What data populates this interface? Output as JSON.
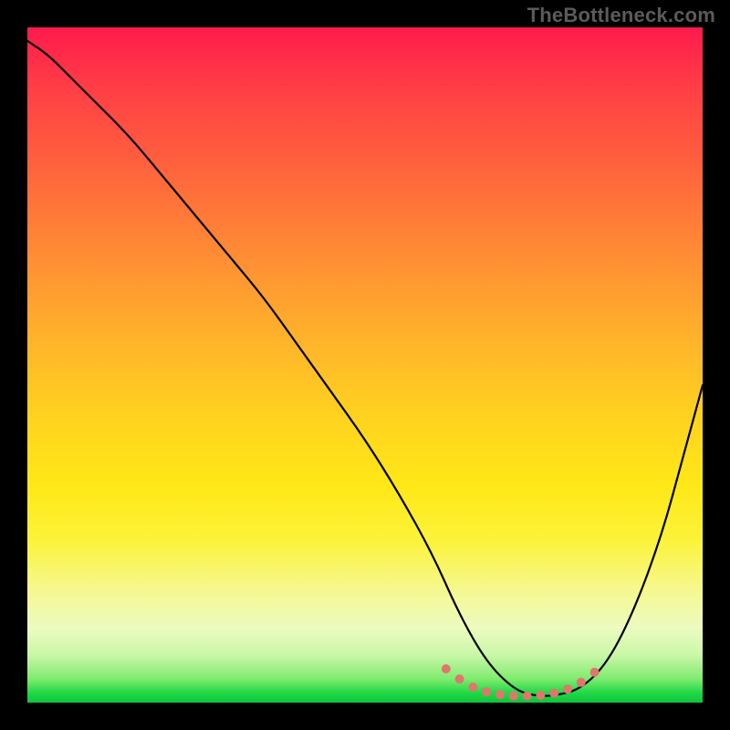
{
  "watermark": "TheBottleneck.com",
  "chart_data": {
    "type": "line",
    "title": "",
    "xlabel": "",
    "ylabel": "",
    "xlim": [
      0,
      100
    ],
    "ylim": [
      0,
      100
    ],
    "gradient_colors": {
      "top": "#ff1a4d",
      "upper_mid": "#ff9a31",
      "mid": "#ffe817",
      "lower_mid": "#ecfbc0",
      "bottom": "#0cc63a"
    },
    "series": [
      {
        "name": "bottleneck-curve",
        "color": "#000000",
        "x": [
          0,
          3,
          6,
          10,
          15,
          20,
          25,
          30,
          35,
          40,
          45,
          50,
          55,
          60,
          64,
          68,
          72,
          75,
          78,
          82,
          86,
          90,
          94,
          97,
          100
        ],
        "y": [
          98,
          96,
          93,
          89,
          84,
          78,
          72,
          66,
          60,
          53,
          46,
          39,
          31,
          22,
          13,
          6,
          2,
          1,
          1,
          2,
          6,
          14,
          25,
          36,
          47
        ]
      },
      {
        "name": "optimal-range-markers",
        "color": "#e0766d",
        "type": "scatter",
        "x": [
          62,
          64,
          66,
          68,
          70,
          72,
          74,
          76,
          78,
          80,
          82,
          84
        ],
        "y": [
          5,
          3.5,
          2.3,
          1.6,
          1.2,
          1.0,
          1.0,
          1.1,
          1.4,
          2.0,
          3.0,
          4.5
        ]
      }
    ]
  }
}
